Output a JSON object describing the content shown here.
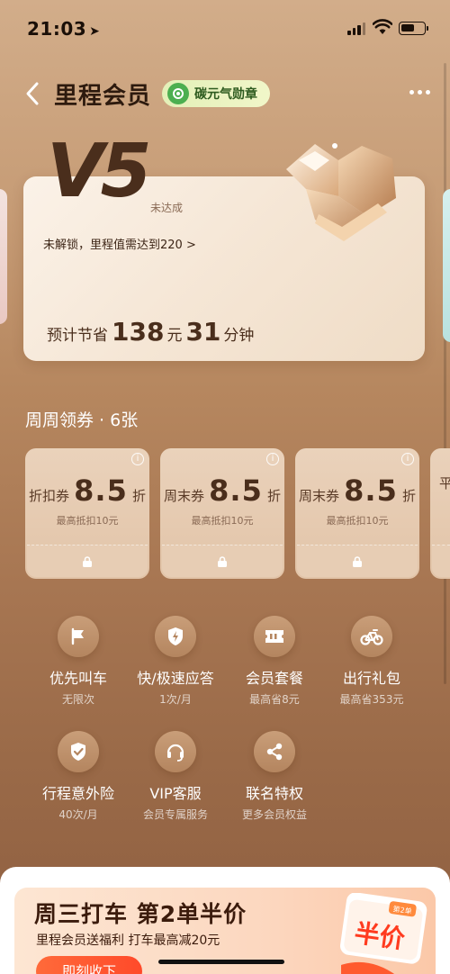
{
  "status_bar": {
    "time": "21:03",
    "battery_level": 0.6
  },
  "header": {
    "back_icon": "chevron-left-icon",
    "title": "里程会员",
    "carbon_badge": "碳元气勋章",
    "more_icon": "more-horizontal-icon"
  },
  "level_card": {
    "level": "V5",
    "status": "未达成",
    "unlock_text": "未解锁，里程值需达到220 >",
    "savings_label": "预计节省",
    "savings_amount": "138",
    "savings_amount_unit": "元",
    "savings_time": "31",
    "savings_time_unit": "分钟"
  },
  "coupons": {
    "title": "周周领券 · 6张",
    "items": [
      {
        "name": "折扣券",
        "rate": "8.5",
        "unit": "折",
        "sub": "最高抵扣10元"
      },
      {
        "name": "周末券",
        "rate": "8.5",
        "unit": "折",
        "sub": "最高抵扣10元"
      },
      {
        "name": "周末券",
        "rate": "8.5",
        "unit": "折",
        "sub": "最高抵扣10元"
      },
      {
        "name": "平",
        "rate": "",
        "unit": "",
        "sub": ""
      }
    ]
  },
  "benefits": [
    {
      "name": "优先叫车",
      "sub": "无限次",
      "icon": "flag-icon"
    },
    {
      "name": "快/极速应答",
      "sub": "1次/月",
      "icon": "shield-bolt-icon"
    },
    {
      "name": "会员套餐",
      "sub": "最高省8元",
      "icon": "ticket-icon"
    },
    {
      "name": "出行礼包",
      "sub": "最高省353元",
      "icon": "bike-icon"
    },
    {
      "name": "行程意外险",
      "sub": "40次/月",
      "icon": "shield-check-icon"
    },
    {
      "name": "VIP客服",
      "sub": "会员专属服务",
      "icon": "headset-icon"
    },
    {
      "name": "联名特权",
      "sub": "更多会员权益",
      "icon": "share-icon"
    }
  ],
  "promo": {
    "title": "周三打车 第2单半价",
    "subtitle": "里程会员送福利 打车最高减20元",
    "button": "即刻收下",
    "tag": "第2单",
    "art_text": "半价"
  },
  "colors": {
    "accent_orange": "#ff5a2e",
    "brand_brown": "#4a2e1c",
    "carbon_green": "#4caf50"
  }
}
